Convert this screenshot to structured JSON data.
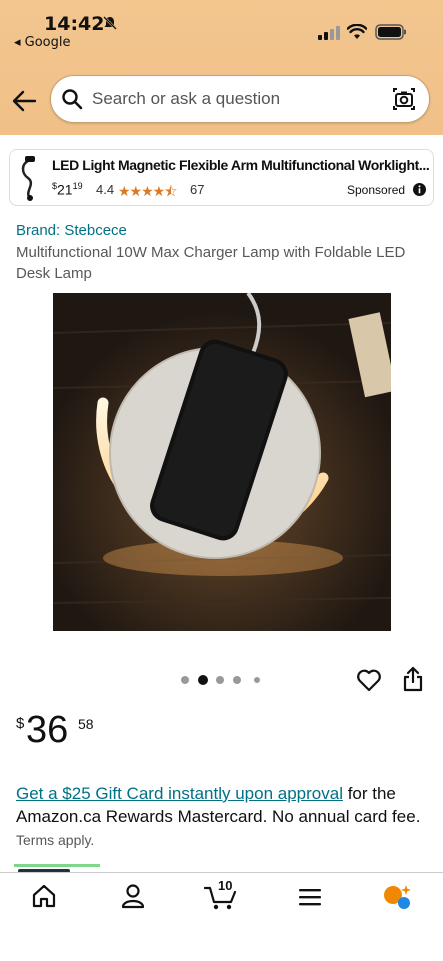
{
  "status": {
    "time": "14:42",
    "back_app": "◂ Google"
  },
  "search": {
    "placeholder": "Search or ask a question"
  },
  "sponsored": {
    "title": "LED Light Magnetic Flexible Arm Multifunctional Worklight...",
    "price_symbol": "$",
    "price_whole": "21",
    "price_fraction": "19",
    "rating": "4.4",
    "stars": "★★★★⯪",
    "review_count": "67",
    "label": "Sponsored"
  },
  "product": {
    "brand": "Brand: Stebcece",
    "title": "Multifunctional 10W Max Charger Lamp with Foldable LED Desk Lamp",
    "image_index": 2,
    "image_count": 5,
    "price_symbol": "$",
    "price_whole": "36",
    "price_fraction": "58"
  },
  "offer": {
    "link_text": "Get a $25 Gift Card instantly upon approval",
    "body_text": " for the Amazon.ca Rewards Mastercard. No annual card fee. ",
    "terms": "Terms apply."
  },
  "nav": {
    "items": [
      "home-icon",
      "account-icon",
      "cart-icon",
      "menu-icon",
      "rufus-icon"
    ],
    "cart_count": "10"
  },
  "colors": {
    "header_bg": "#f3c68f",
    "link": "#007185",
    "star": "#de7921"
  }
}
